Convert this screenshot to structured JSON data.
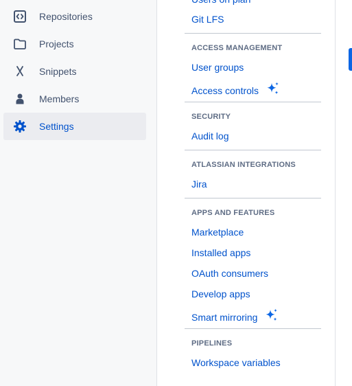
{
  "sidebar": {
    "items": [
      {
        "label": "Repositories",
        "icon": "code-repository-icon"
      },
      {
        "label": "Projects",
        "icon": "folder-icon"
      },
      {
        "label": "Snippets",
        "icon": "scissors-icon"
      },
      {
        "label": "Members",
        "icon": "person-icon"
      },
      {
        "label": "Settings",
        "icon": "gear-icon",
        "active": true
      }
    ]
  },
  "settings": {
    "users_on_plan": "Users on plan",
    "git_lfs": "Git LFS",
    "access_management": {
      "heading": "ACCESS MANAGEMENT",
      "user_groups": "User groups",
      "access_controls": "Access controls"
    },
    "security": {
      "heading": "SECURITY",
      "audit_log": "Audit log"
    },
    "atlassian_integrations": {
      "heading": "ATLASSIAN INTEGRATIONS",
      "jira": "Jira"
    },
    "apps_and_features": {
      "heading": "APPS AND FEATURES",
      "marketplace": "Marketplace",
      "installed_apps": "Installed apps",
      "oauth_consumers": "OAuth consumers",
      "develop_apps": "Develop apps",
      "smart_mirroring": "Smart mirroring"
    },
    "pipelines": {
      "heading": "PIPELINES",
      "workspace_variables": "Workspace variables"
    }
  },
  "colors": {
    "link": "#0052cc",
    "heading": "#5e6c84",
    "active_bg": "#ebecf0",
    "sidebar_bg": "#f7f8f9",
    "sparkle": "#0c66e4"
  }
}
